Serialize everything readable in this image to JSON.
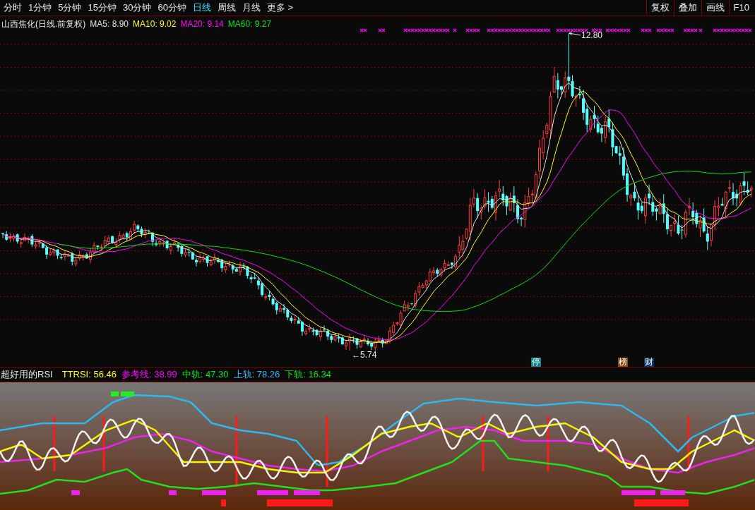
{
  "period_tabs": [
    {
      "label": "分时",
      "selected": false
    },
    {
      "label": "1分钟",
      "selected": false
    },
    {
      "label": "5分钟",
      "selected": false
    },
    {
      "label": "15分钟",
      "selected": false
    },
    {
      "label": "30分钟",
      "selected": false
    },
    {
      "label": "60分钟",
      "selected": false
    },
    {
      "label": "日线",
      "selected": true
    },
    {
      "label": "周线",
      "selected": false
    },
    {
      "label": "月线",
      "selected": false
    }
  ],
  "more": {
    "label": "更多",
    "chevron": ">"
  },
  "toolbar_buttons": [
    "复权",
    "叠加",
    "画线",
    "F10"
  ],
  "main_chart": {
    "title": "山西焦化(日线.前复权)",
    "moving_averages": [
      {
        "label": "MA5: 8.90",
        "color": "#e0e0e0"
      },
      {
        "label": "MA10: 9.02",
        "color": "#ffff00"
      },
      {
        "label": "MA20: 9.14",
        "color": "#ff00ff"
      },
      {
        "label": "MA60: 9.27",
        "color": "#00e600"
      }
    ],
    "high_label": "12.80",
    "low_label": "←5.74",
    "event_badges": [
      {
        "label": "停",
        "color": "#0e8585"
      },
      {
        "label": "榜",
        "color": "#8a4a12"
      },
      {
        "label": "财",
        "color": "#0b3566"
      }
    ]
  },
  "indicator": {
    "title": "超好用的RSI",
    "values": [
      {
        "label": "TTRSI: 56.46",
        "color": "#ffff00"
      },
      {
        "label": "参考线: 38.99",
        "color": "#ff00ff"
      },
      {
        "label": "中轨: 47.30",
        "color": "#00e600"
      },
      {
        "label": "上轨: 78.26",
        "color": "#33b5ff"
      },
      {
        "label": "下轨: 16.34",
        "color": "#00e600"
      }
    ]
  }
}
